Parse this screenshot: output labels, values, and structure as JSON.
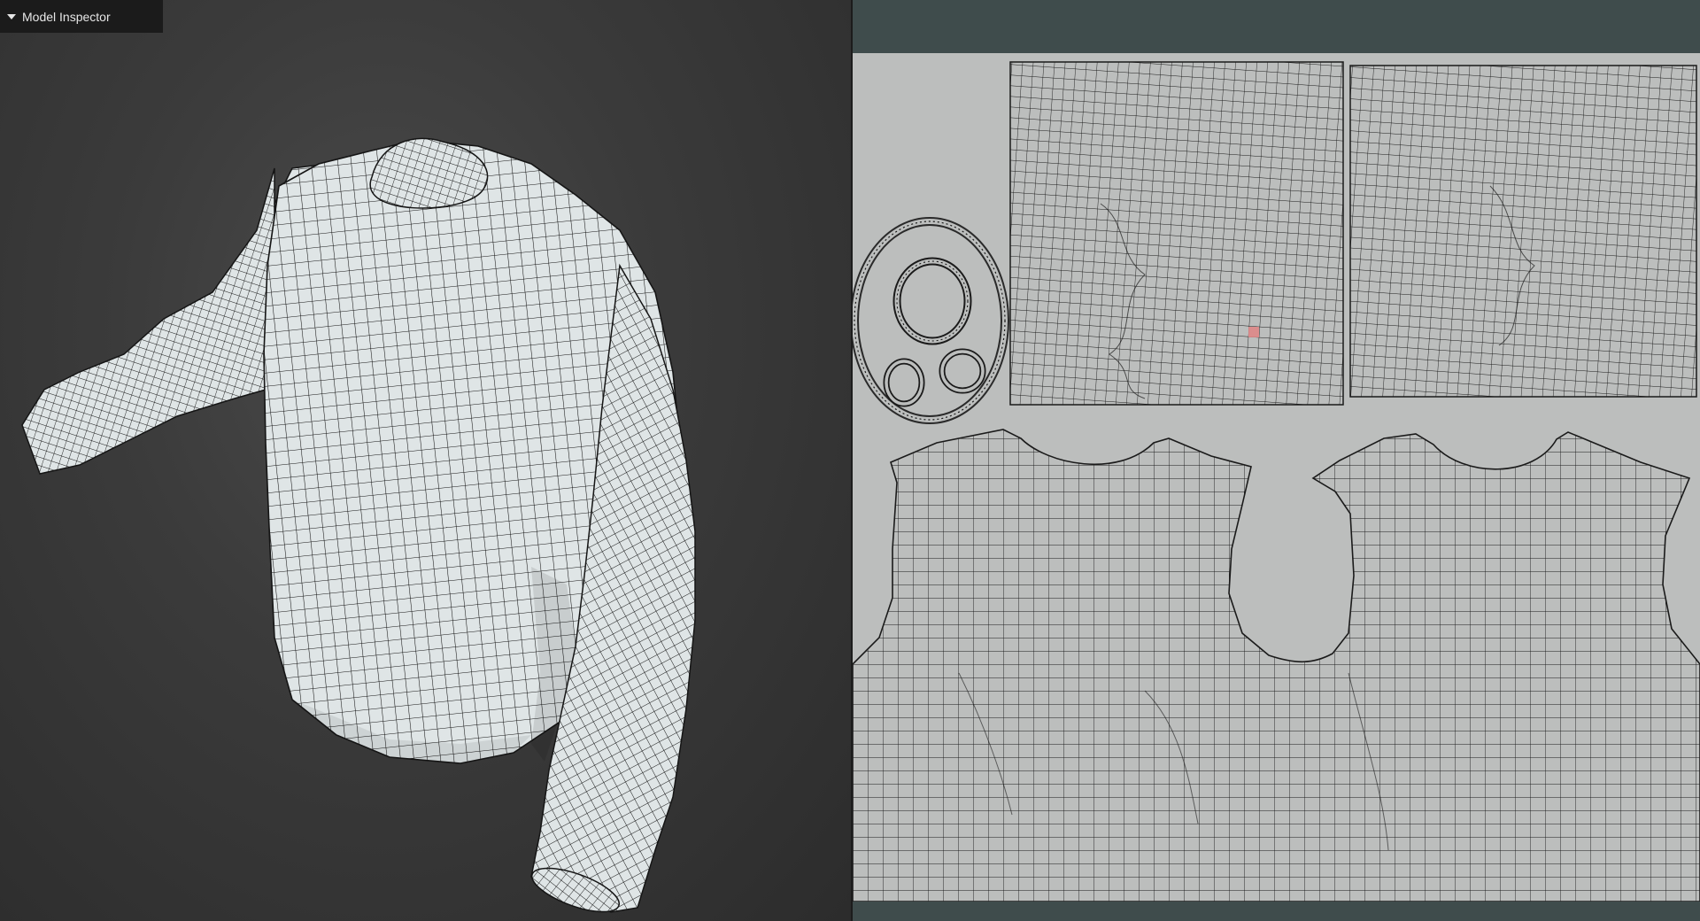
{
  "inspector": {
    "title": "Model Inspector",
    "toggle_icon": "triangle-down-icon"
  },
  "viewport": {
    "background": "#3b3b3b",
    "mesh_fill": "#dfe5e6",
    "wire_color": "#151515"
  },
  "uv_editor": {
    "background": "#bcbebd",
    "frame_color": "#3f4c4c",
    "selection_color": "#e08585"
  }
}
